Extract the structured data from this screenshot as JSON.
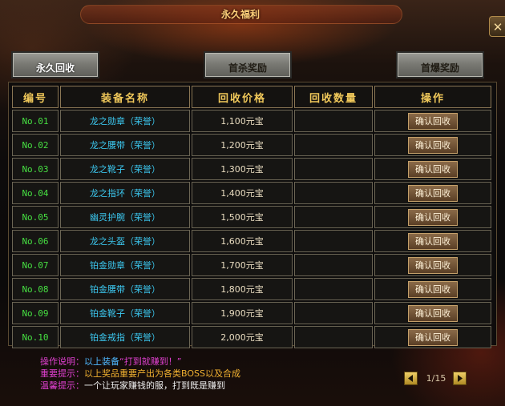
{
  "window": {
    "title": "永久福利",
    "close_label": "✕"
  },
  "tabs": [
    {
      "label": "永久回收",
      "active": true
    },
    {
      "label": "首杀奖励",
      "active": false
    },
    {
      "label": "首爆奖励",
      "active": false
    }
  ],
  "table": {
    "headers": [
      "编号",
      "装备名称",
      "回收价格",
      "回收数量",
      "操作"
    ],
    "rows": [
      {
        "no": "No.01",
        "name": "龙之勋章（荣誉）",
        "price": "1,100元宝",
        "qty": "",
        "action": "确认回收"
      },
      {
        "no": "No.02",
        "name": "龙之腰带（荣誉）",
        "price": "1,200元宝",
        "qty": "",
        "action": "确认回收"
      },
      {
        "no": "No.03",
        "name": "龙之靴子（荣誉）",
        "price": "1,300元宝",
        "qty": "",
        "action": "确认回收"
      },
      {
        "no": "No.04",
        "name": "龙之指环（荣誉）",
        "price": "1,400元宝",
        "qty": "",
        "action": "确认回收"
      },
      {
        "no": "No.05",
        "name": "幽灵护腕（荣誉）",
        "price": "1,500元宝",
        "qty": "",
        "action": "确认回收"
      },
      {
        "no": "No.06",
        "name": "龙之头盔（荣誉）",
        "price": "1,600元宝",
        "qty": "",
        "action": "确认回收"
      },
      {
        "no": "No.07",
        "name": "铂金勋章（荣誉）",
        "price": "1,700元宝",
        "qty": "",
        "action": "确认回收"
      },
      {
        "no": "No.08",
        "name": "铂金腰带（荣誉）",
        "price": "1,800元宝",
        "qty": "",
        "action": "确认回收"
      },
      {
        "no": "No.09",
        "name": "铂金靴子（荣誉）",
        "price": "1,900元宝",
        "qty": "",
        "action": "确认回收"
      },
      {
        "no": "No.10",
        "name": "铂金戒指（荣誉）",
        "price": "2,000元宝",
        "qty": "",
        "action": "确认回收"
      }
    ]
  },
  "notes": {
    "operation_label": "操作说明：",
    "operation_text": "以上装备",
    "operation_quote": "“打到就赚到！”",
    "important_label": "重要提示：",
    "important_text": "以上奖品重要产出为各类BOSS以及合成",
    "warm_label": "温馨提示：",
    "warm_text": "一个让玩家赚钱的服，打到既是赚到"
  },
  "pager": {
    "indicator": "1/15"
  },
  "icons": {
    "prev": "triangle-left-icon",
    "next": "triangle-right-icon",
    "close": "close-icon"
  }
}
